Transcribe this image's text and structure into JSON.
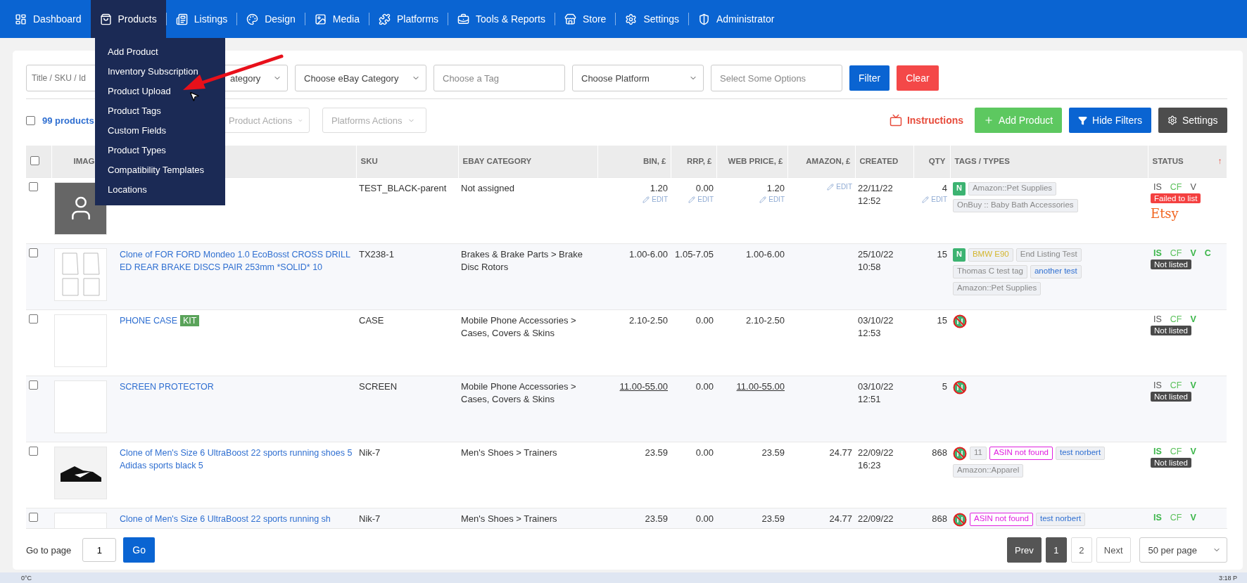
{
  "nav": {
    "items": [
      {
        "label": "Dashboard",
        "selected": false
      },
      {
        "label": "Products",
        "selected": true
      },
      {
        "label": "Listings",
        "selected": false
      },
      {
        "label": "Design",
        "selected": false
      },
      {
        "label": "Media",
        "selected": false
      },
      {
        "label": "Platforms",
        "selected": false
      },
      {
        "label": "Tools & Reports",
        "selected": false
      },
      {
        "label": "Store",
        "selected": false
      },
      {
        "label": "Settings",
        "selected": false
      },
      {
        "label": "Administrator",
        "selected": false
      }
    ],
    "menu": [
      {
        "label": "Add Product",
        "selected": false
      },
      {
        "label": "Inventory Subscription",
        "selected": false
      },
      {
        "label": "Product Upload",
        "selected": false
      },
      {
        "label": "Product Tags",
        "selected": false
      },
      {
        "label": "Custom Fields",
        "selected": false
      },
      {
        "label": "Product Types",
        "selected": false
      },
      {
        "label": "Compatibility Templates",
        "selected": false
      },
      {
        "label": "Locations",
        "selected": false
      }
    ]
  },
  "filters": {
    "search": {
      "placeholder": "Title / SKU / Id"
    },
    "selects": [
      {
        "text": "ategory",
        "kind": "covered"
      },
      {
        "text": "Choose eBay Category",
        "kind": "select"
      },
      {
        "text": "Choose a Tag",
        "kind": "field"
      },
      {
        "text": "Choose Platform",
        "kind": "select"
      },
      {
        "text": "Select Some Options",
        "kind": "field"
      }
    ],
    "filter_button": "Filter",
    "clear_button": "Clear"
  },
  "actions": {
    "select_all_checked": false,
    "count": "99 products",
    "dropdowns": [
      {
        "text": "Product Actions",
        "kind": "covered"
      },
      {
        "text": "Platforms Actions",
        "kind": "select"
      }
    ],
    "instructions": "Instructions",
    "add_product": "Add Product",
    "hide_filters": "Hide Filters",
    "settings": "Settings"
  },
  "table": {
    "header_checked": false,
    "columns": [
      "IMAG",
      "",
      "SKU",
      "EBAY CATEGORY",
      "BIN, £",
      "RRP, £",
      "WEB PRICE, £",
      "AMAZON, £",
      "CREATED",
      "QTY",
      "TAGS / TYPES",
      "STATUS"
    ],
    "sort_mark": "↑",
    "rows": [
      {
        "checked": false,
        "kind": "avatar",
        "sku": "TEST_BLACK-parent",
        "category": "Not assigned",
        "bin": {
          "value": "1.20",
          "edit": "EDIT",
          "underlined": false
        },
        "rrp": {
          "value": "0.00",
          "edit": "EDIT",
          "underlined": false
        },
        "web": {
          "value": "1.20",
          "edit": "EDIT",
          "underlined": false
        },
        "amazon": {
          "edit": "EDIT"
        },
        "created": [
          "22/11/22",
          "12:52"
        ],
        "qty": {
          "value": "4",
          "edit": "EDIT",
          "underlined": false
        },
        "tags": [
          {
            "kind": "n",
            "text": "N"
          },
          {
            "kind": "tag",
            "text": "Amazon::Pet Supplies",
            "color": "#888888"
          },
          {
            "kind": "tag",
            "text": "OnBuy :: Baby Bath Accessories",
            "color": "#888888"
          }
        ],
        "flags": [
          {
            "label": "IS",
            "color": "#555555",
            "on": false
          },
          {
            "label": "CF",
            "color": "#5cc15c",
            "on": false
          },
          {
            "label": "V",
            "color": "#555555",
            "on": false
          }
        ],
        "badge": {
          "text": "Failed to list",
          "kind": "failed"
        },
        "platform": "Etsy"
      },
      {
        "checked": false,
        "kind": "mats",
        "title": "Clone of FOR FORD Mondeo 1.0 EcoBosst CROSS DRILLED REAR BRAKE DISCS PAIR 253mm *SOLID* 10",
        "sku": "TX238-1",
        "category": "Brakes & Brake Parts > Brake Disc Rotors",
        "bin": {
          "value": "1.00-6.00",
          "underlined": false
        },
        "rrp": {
          "value": "1.05-7.05",
          "underlined": false
        },
        "web": {
          "value": "1.00-6.00",
          "underlined": false
        },
        "created": [
          "25/10/22",
          "10:58"
        ],
        "qty": {
          "value": "15",
          "underlined": false
        },
        "tags": [
          {
            "kind": "n",
            "text": "N"
          },
          {
            "kind": "tag",
            "text": "BMW E90",
            "color": "#d4b630"
          },
          {
            "kind": "tag",
            "text": "End Listing Test",
            "color": "#888888"
          },
          {
            "kind": "tag",
            "text": "Thomas C test tag",
            "color": "#888888"
          },
          {
            "kind": "tag",
            "text": "another test",
            "color": "#2f6fd1"
          },
          {
            "kind": "tag",
            "text": "Amazon::Pet Supplies",
            "color": "#888888"
          }
        ],
        "flags": [
          {
            "label": "IS",
            "color": "#3cb64a",
            "on": true
          },
          {
            "label": "CF",
            "color": "#5cc15c",
            "on": false
          },
          {
            "label": "V",
            "color": "#3cb64a",
            "on": true
          },
          {
            "label": "C",
            "color": "#3cb64a",
            "on": true
          }
        ],
        "badge": {
          "text": "Not listed",
          "kind": "not-listed"
        }
      },
      {
        "checked": false,
        "kind": "blank",
        "title": "PHONE CASE",
        "kit": "KIT",
        "sku": "CASE",
        "category": "Mobile Phone Accessories > Cases, Covers & Skins",
        "bin": {
          "value": "2.10-2.50",
          "underlined": false
        },
        "rrp": {
          "value": "0.00",
          "underlined": false
        },
        "web": {
          "value": "2.10-2.50",
          "underlined": false
        },
        "created": [
          "03/10/22",
          "12:53"
        ],
        "qty": {
          "value": "15",
          "underlined": false
        },
        "tags": [
          {
            "kind": "no-n"
          }
        ],
        "flags": [
          {
            "label": "IS",
            "color": "#555555",
            "on": false
          },
          {
            "label": "CF",
            "color": "#5cc15c",
            "on": false
          },
          {
            "label": "V",
            "color": "#3cb64a",
            "on": true
          }
        ],
        "badge": {
          "text": "Not listed",
          "kind": "not-listed"
        }
      },
      {
        "checked": false,
        "kind": "blank",
        "title": "SCREEN PROTECTOR",
        "sku": "SCREEN",
        "category": "Mobile Phone Accessories > Cases, Covers & Skins",
        "bin": {
          "value": "11.00-55.00",
          "underlined": true
        },
        "rrp": {
          "value": "0.00",
          "underlined": false
        },
        "web": {
          "value": "11.00-55.00",
          "underlined": true
        },
        "created": [
          "03/10/22",
          "12:51"
        ],
        "qty": {
          "value": "5",
          "underlined": false
        },
        "tags": [
          {
            "kind": "no-n"
          }
        ],
        "flags": [
          {
            "label": "IS",
            "color": "#555555",
            "on": false
          },
          {
            "label": "CF",
            "color": "#5cc15c",
            "on": false
          },
          {
            "label": "V",
            "color": "#3cb64a",
            "on": true
          }
        ],
        "badge": {
          "text": "Not listed",
          "kind": "not-listed"
        }
      },
      {
        "checked": false,
        "kind": "shoe",
        "title": "Clone of Men's Size 6 UltraBoost 22 sports running shoes 5 Adidas sports black 5",
        "sku": "Nik-7",
        "category": "Men's Shoes > Trainers",
        "bin": {
          "value": "23.59",
          "underlined": false
        },
        "rrp": {
          "value": "0.00",
          "underlined": false
        },
        "web": {
          "value": "23.59",
          "underlined": false
        },
        "amazon": {
          "value": "24.77",
          "underlined": false
        },
        "created": [
          "22/09/22",
          "16:23"
        ],
        "qty": {
          "value": "868",
          "underlined": false
        },
        "tags": [
          {
            "kind": "no-n"
          },
          {
            "kind": "tag",
            "text": "11",
            "color": "#888888"
          },
          {
            "kind": "outline",
            "text": "ASIN not found",
            "color": "#e020e0"
          },
          {
            "kind": "tag",
            "text": "test norbert",
            "color": "#2f6fd1"
          },
          {
            "kind": "tag",
            "text": "Amazon::Apparel",
            "color": "#888888"
          }
        ],
        "flags": [
          {
            "label": "IS",
            "color": "#3cb64a",
            "on": true
          },
          {
            "label": "CF",
            "color": "#5cc15c",
            "on": false
          },
          {
            "label": "V",
            "color": "#3cb64a",
            "on": true
          }
        ],
        "badge": {
          "text": "Not listed",
          "kind": "not-listed"
        }
      },
      {
        "checked": false,
        "kind": "blank",
        "title": "Clone of Men's Size 6 UltraBoost 22 sports running sh",
        "sku": "Nik-7",
        "category": "Men's Shoes > Trainers",
        "bin": {
          "value": "23.59",
          "underlined": false
        },
        "rrp": {
          "value": "0.00",
          "underlined": false
        },
        "web": {
          "value": "23.59",
          "underlined": false
        },
        "amazon": {
          "value": "24.77",
          "underlined": false
        },
        "created": [
          "22/09/22"
        ],
        "qty": {
          "value": "868",
          "underlined": false
        },
        "tags": [
          {
            "kind": "no-n"
          },
          {
            "kind": "outline",
            "text": "ASIN not found",
            "color": "#e020e0"
          },
          {
            "kind": "tag",
            "text": "test norbert",
            "color": "#2f6fd1"
          }
        ],
        "flags": [
          {
            "label": "IS",
            "color": "#3cb64a",
            "on": true
          },
          {
            "label": "CF",
            "color": "#5cc15c",
            "on": false
          },
          {
            "label": "V",
            "color": "#3cb64a",
            "on": true
          }
        ]
      }
    ]
  },
  "pagination": {
    "go_label": "Go to page",
    "page_value": "1",
    "go_button": "Go",
    "prev": "Prev",
    "pages": [
      {
        "label": "1",
        "selected": true
      },
      {
        "label": "2",
        "selected": false
      }
    ],
    "next": "Next",
    "per_page": "50 per page"
  },
  "taskbar": {
    "weather": "0°C",
    "clock": "3:18 P"
  }
}
